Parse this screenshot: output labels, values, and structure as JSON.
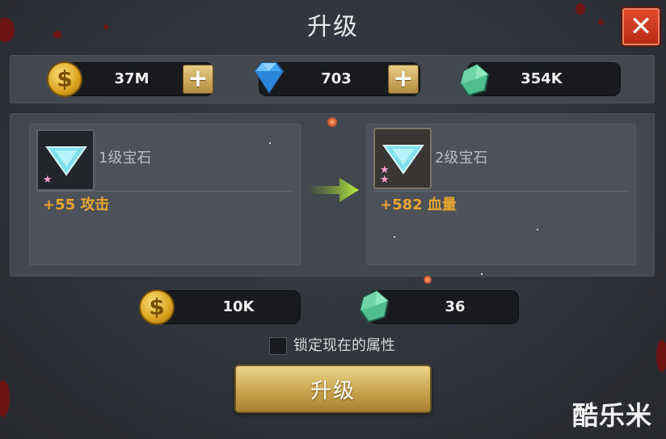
{
  "window": {
    "title": "升级",
    "close_icon": "close-icon"
  },
  "resources": {
    "gold": {
      "icon": "gold-coin-icon",
      "value": "37M"
    },
    "diamond": {
      "icon": "diamond-icon",
      "value": "703"
    },
    "crystal": {
      "icon": "green-crystal-icon",
      "value": "354K"
    },
    "plus_icon": "plus-icon"
  },
  "current_gem": {
    "icon": "triangle-gem-icon",
    "stars": 1,
    "name": "1级宝石",
    "stat": "+55 攻击"
  },
  "next_gem": {
    "icon": "triangle-gem-icon",
    "stars": 2,
    "name": "2级宝石",
    "stat": "+582 血量"
  },
  "arrow_icon": "green-arrow-right-icon",
  "cost": {
    "gold": {
      "icon": "gold-coin-icon",
      "value": "10K"
    },
    "crystal": {
      "icon": "green-crystal-icon",
      "value": "36"
    }
  },
  "lock_option": {
    "label": "锁定现在的属性",
    "checked": false
  },
  "upgrade_button": {
    "label": "升级"
  },
  "watermark": "酷乐米",
  "colors": {
    "stat_text": "#e8a530",
    "close_button": "#d0391f",
    "button_gold": "#c9a44f"
  }
}
